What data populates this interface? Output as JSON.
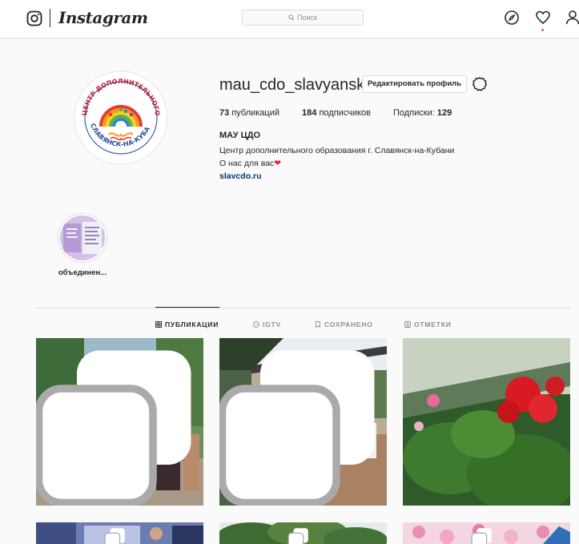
{
  "nav": {
    "brand": "Instagram",
    "search_placeholder": "Поиск",
    "icons": [
      "instagram-glyph-icon",
      "compass-icon",
      "heart-icon",
      "user-icon"
    ]
  },
  "profile": {
    "username": "mau_cdo_slavyansk",
    "edit_label": "Редактировать профиль",
    "stats": {
      "posts_count": "73",
      "posts_label": "публикаций",
      "followers_count": "184",
      "followers_label": "подписчиков",
      "following_label": "Подписки:",
      "following_count": "129"
    },
    "full_name": "МАУ ЦДО",
    "bio_line1": "Центр дополнительного образования г. Славянск-на-Кубани",
    "bio_line2": "О нас для вас",
    "website": "slavcdo.ru"
  },
  "highlights": [
    {
      "label": "объединен..."
    }
  ],
  "tabs": [
    {
      "label": "ПУБЛИКАЦИИ",
      "icon": "grid-icon",
      "active": true
    },
    {
      "label": "IGTV",
      "icon": "igtv-icon",
      "active": false
    },
    {
      "label": "СОХРАНЕНО",
      "icon": "bookmark-icon",
      "active": false
    },
    {
      "label": "ОТМЕТКИ",
      "icon": "tag-icon",
      "active": false
    }
  ],
  "posts": [
    {
      "desc": "group-photo"
    },
    {
      "desc": "conservatory-meeting"
    },
    {
      "desc": "red-geraniums"
    },
    {
      "desc": "event-stage"
    },
    {
      "desc": "trees"
    },
    {
      "desc": "pink-flowers"
    }
  ],
  "colors": {
    "accent": "#0095f6",
    "link": "#00376b",
    "notification": "#ed4956"
  }
}
